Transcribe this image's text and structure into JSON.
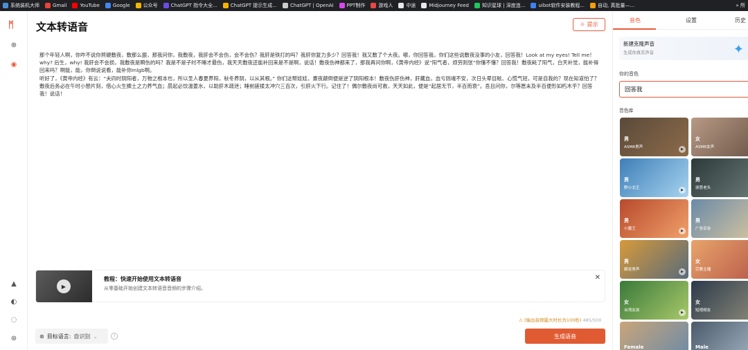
{
  "bookmarks": [
    {
      "label": "系统装机大师",
      "color": "#4a90d9"
    },
    {
      "label": "Gmail",
      "color": "#ea4335"
    },
    {
      "label": "YouTube",
      "color": "#ff0000"
    },
    {
      "label": "Google",
      "color": "#4285f4"
    },
    {
      "label": "公众号",
      "color": "#f4b400"
    },
    {
      "label": "ChatGPT 指令大全...",
      "color": "#6b4ce6"
    },
    {
      "label": "ChatGPT 提示生成...",
      "color": "#f4b400"
    },
    {
      "label": "ChatGPT | OpenAI",
      "color": "#cccccc"
    },
    {
      "label": "PPT制作",
      "color": "#d946ef"
    },
    {
      "label": "游戏人",
      "color": "#ef4444"
    },
    {
      "label": "中途",
      "color": "#e5e7eb"
    },
    {
      "label": "Midjourney Feed",
      "color": "#e5e7eb"
    },
    {
      "label": "知识星球 | 深度连...",
      "color": "#22c55e"
    },
    {
      "label": "uibot软件安装教程...",
      "color": "#3b82f6"
    },
    {
      "label": "自动, 真批量—...",
      "color": "#f59e0b"
    }
  ],
  "bookmarks_more": "»  所",
  "app": {
    "title": "文本转语音",
    "hint": "提示",
    "content": "那个年轻人啊，你咋不说你熬硬敷夜，敷那么狠，那我问你，我敷夜，我肝会不会伤，会不会伤？我肝是铁打的吗？我肝你复力多少？回答我！我又敷了个大夜。哪，你回答我，你们这些说敷夜没事的小友，回答我！Look at my eyes! Tell me！ why? 后生，why! 我肝会不会损，我敷夜是瞬伤的吗？我是不是子时不睡才最伤，我天天敷夜还能补回来是不是啊，说话！敷夜伤神都来了，那我再问你啊，《黄帝内经》说“阳气者，烦劳则张”你懂不懂？回答我！敷夜耗了阳气，白天补觉，能补得回来吗？啊能，能，你倒说说看，能补你mlgb啊。\n听好了，《黄帝内经》有云：“夫四时阴阳者，万物之根本也，所以圣人春夏养阳，秋冬养阴，以从其根。” 你们这帮娃娃，晝夜颠倒便是逆了阴阳根本！敷夜伤肝伤神，肝藏血，血亏则魂不安，次日头晕目眩、心慌气短，可是自我的？现在知道怕了？敷夜后务必在午时小憩片刻，借心火生脾土之力养气血；晨起必饮温姜水，以助肝木疏泄；睡前搓揉太冲穴三百次，引肝火下行。记住了！偶尔敷夜尚可救，天天如此，便是“起居无节，半百而衰”。吾且问你，尔等愿未及半百便形如朽木乎？回答我！说话！",
    "tutorial_title": "教程：快速开始使用文本转语音",
    "tutorial_desc": "从零基础开始创建文本转语音音频的步骤介绍。",
    "limit_warning": "⚠ (输出音频最大时长为100秒)",
    "char_count": "485/500",
    "target_lang_label": "目标语言:",
    "target_lang_value": "自识别",
    "generate_label": "生成语音"
  },
  "panel": {
    "tabs": [
      "音色",
      "设置",
      "历史"
    ],
    "clone_title": "新建克隆声音",
    "clone_sub": "生成你真实声音",
    "your_voice_label": "你的音色",
    "your_voice_value": "回答我",
    "library_label": "音色库",
    "voices": [
      {
        "gender": "男",
        "name": "ASMR男声",
        "colors": [
          "#5a4a3a",
          "#8c6b4a"
        ]
      },
      {
        "gender": "女",
        "name": "ASMR女声",
        "colors": [
          "#b79a85",
          "#6b5446"
        ]
      },
      {
        "gender": "男",
        "name": "野小北王",
        "colors": [
          "#3e7fb8",
          "#a7d3ef"
        ]
      },
      {
        "gender": "男",
        "name": "邪恶老头",
        "colors": [
          "#2c3a3a",
          "#6b7b78"
        ]
      },
      {
        "gender": "男",
        "name": "小魔王",
        "colors": [
          "#b84a2c",
          "#f0a06a"
        ]
      },
      {
        "gender": "男",
        "name": "广告宏谷",
        "colors": [
          "#6a8aa8",
          "#d8c6a0"
        ]
      },
      {
        "gender": "男",
        "name": "解说男声",
        "colors": [
          "#d79a3a",
          "#5a6b7a"
        ]
      },
      {
        "gender": "女",
        "name": "宗教主播",
        "colors": [
          "#e8a46a",
          "#b85a4a"
        ]
      },
      {
        "gender": "女",
        "name": "台湾女孩",
        "colors": [
          "#3a7a3a",
          "#a8c86a"
        ]
      },
      {
        "gender": "女",
        "name": "短视频女",
        "colors": [
          "#2c3a4a",
          "#8c8a7a"
        ]
      },
      {
        "gender": "",
        "name": "Female",
        "colors": [
          "#c9a57a",
          "#6a8aa8"
        ]
      },
      {
        "gender": "",
        "name": "Male",
        "colors": [
          "#4a5a6a",
          "#a8b8c8"
        ]
      }
    ]
  }
}
